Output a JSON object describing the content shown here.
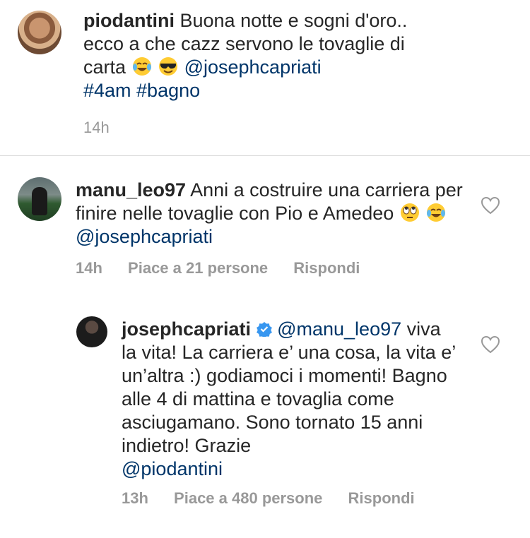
{
  "caption": {
    "username": "piodantini",
    "text": "Buona notte e sogni d'oro.. ecco a che cazz servono le tovaglie di carta",
    "emojis": [
      "face-with-tears-of-joy",
      "smiling-face-with-sunglasses"
    ],
    "mention": "@josephcapriati",
    "hashtags": "#4am #bagno",
    "time": "14h"
  },
  "comments": [
    {
      "username": "manu_leo97",
      "text": "Anni a costruire una carriera per finire nelle tovaglie con Pio e Amedeo",
      "emojis": [
        "face-with-rolling-eyes",
        "face-with-tears-of-joy"
      ],
      "mention": "@josephcapriati",
      "time": "14h",
      "likes": "Piace a 21 persone",
      "reply_label": "Rispondi"
    },
    {
      "username": "josephcapriati",
      "verified": true,
      "mention_start": "@manu_leo97",
      "text": "viva la vita! La carriera e’ una cosa, la vita e’ un’altra :) godiamoci i momenti! Bagno alle 4 di mattina e tovaglia come asciugamano. Sono tornato 15 anni indietro! Grazie",
      "mention_end": "@piodantini",
      "time": "13h",
      "likes": "Piace a 480 persone",
      "reply_label": "Rispondi"
    }
  ],
  "colors": {
    "text": "#262626",
    "mention": "#003569",
    "meta": "#999999",
    "verified": "#3897f0"
  }
}
